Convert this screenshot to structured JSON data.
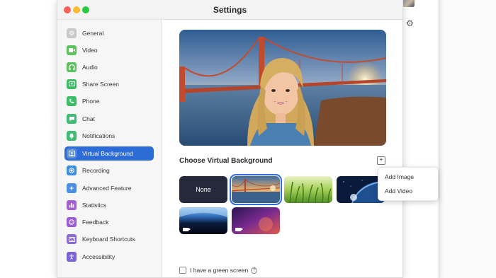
{
  "window": {
    "title": "Settings"
  },
  "sidebar": {
    "items": [
      {
        "label": "General",
        "icon": "gear-icon",
        "color": "#c9c9c9",
        "active": false
      },
      {
        "label": "Video",
        "icon": "video-icon",
        "color": "#5cc25f",
        "active": false
      },
      {
        "label": "Audio",
        "icon": "headphones-icon",
        "color": "#5cc25f",
        "active": false
      },
      {
        "label": "Share Screen",
        "icon": "share-screen-icon",
        "color": "#3ebc66",
        "active": false
      },
      {
        "label": "Phone",
        "icon": "phone-icon",
        "color": "#3ebc66",
        "active": false
      },
      {
        "label": "Chat",
        "icon": "chat-icon",
        "color": "#3dbd74",
        "active": false
      },
      {
        "label": "Notifications",
        "icon": "bell-icon",
        "color": "#3dbd74",
        "active": false
      },
      {
        "label": "Virtual Background",
        "icon": "virtual-background-icon",
        "color": "#2d6bd6",
        "active": true
      },
      {
        "label": "Recording",
        "icon": "record-icon",
        "color": "#3f8de0",
        "active": false
      },
      {
        "label": "Advanced Feature",
        "icon": "sparkle-icon",
        "color": "#4a8fe3",
        "active": false
      },
      {
        "label": "Statistics",
        "icon": "bar-chart-icon",
        "color": "#a55ed6",
        "active": false
      },
      {
        "label": "Feedback",
        "icon": "smile-icon",
        "color": "#9b5ad6",
        "active": false
      },
      {
        "label": "Keyboard Shortcuts",
        "icon": "keyboard-icon",
        "color": "#8a6ad6",
        "active": false
      },
      {
        "label": "Accessibility",
        "icon": "accessibility-icon",
        "color": "#7b63d3",
        "active": false
      }
    ]
  },
  "main": {
    "section_title": "Choose Virtual Background",
    "add_button": "+",
    "thumbnails": [
      {
        "label": "None",
        "kind": "none"
      },
      {
        "kind": "golden-gate-bridge",
        "selected": true
      },
      {
        "kind": "grass"
      },
      {
        "kind": "earth-from-space"
      },
      {
        "kind": "earth-horizon",
        "video": true
      },
      {
        "kind": "purple-nebula",
        "video": true
      }
    ],
    "green_screen_label": "I have a green screen",
    "help_glyph": "?"
  },
  "popup": {
    "items": [
      "Add Image",
      "Add Video"
    ]
  },
  "colors": {
    "accent": "#2d6bd6",
    "close": "#fc5f57",
    "minimize": "#fdbc2e",
    "maximize": "#28c840"
  }
}
